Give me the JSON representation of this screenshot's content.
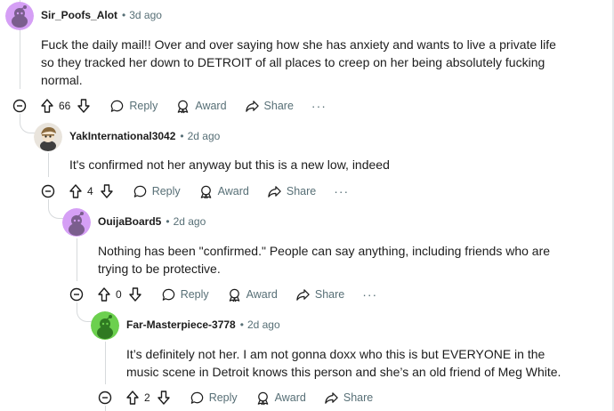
{
  "comments": [
    {
      "username": "Sir_Poofs_Alot",
      "time": "3d ago",
      "body_lines": [
        "Fuck the daily mail!! Over and over saying how she has anxiety and wants to live a private life",
        "so they tracked her down to DETROIT of all places to creep on her being absolutely fucking",
        "normal."
      ],
      "votes": "66",
      "reply_label": "Reply",
      "award_label": "Award",
      "share_label": "Share",
      "more_label": "···",
      "avatar_color": "#d59ff5"
    },
    {
      "username": "YakInternational3042",
      "time": "2d ago",
      "body_lines": [
        "It's confirmed not her anyway but this is a new low, indeed"
      ],
      "votes": "4",
      "reply_label": "Reply",
      "award_label": "Award",
      "share_label": "Share",
      "more_label": "···",
      "avatar_color": "#e9e4dc"
    },
    {
      "username": "OuijaBoard5",
      "time": "2d ago",
      "body_lines": [
        "Nothing has been \"confirmed.\" People can say anything, including friends who are",
        "trying to be protective."
      ],
      "votes": "0",
      "reply_label": "Reply",
      "award_label": "Award",
      "share_label": "Share",
      "more_label": "···",
      "avatar_color": "#d59ff5"
    },
    {
      "username": "Far-Masterpiece-3778",
      "time": "2d ago",
      "body_lines": [
        "It’s definitely not her. I am not gonna doxx who this is but EVERYONE in the",
        "music scene in Detroit knows this person and she’s an old friend of Meg White."
      ],
      "votes": "2",
      "reply_label": "Reply",
      "award_label": "Award",
      "share_label": "Share",
      "avatar_color": "#6cd04e"
    }
  ],
  "colors": {
    "meta": "#576f76",
    "text": "#1c1c1c",
    "thread": "#d7dadc"
  }
}
